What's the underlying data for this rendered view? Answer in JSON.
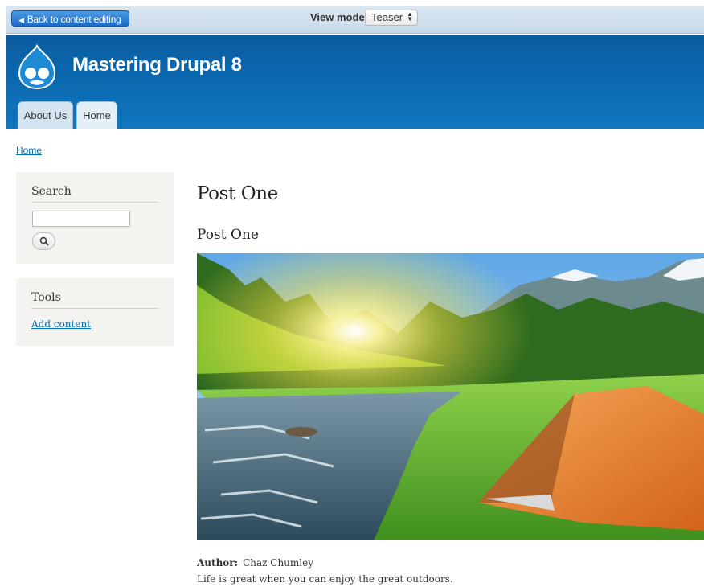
{
  "preview": {
    "back_label": "Back to content editing",
    "view_mode_label": "View mode:",
    "view_mode_value": "Teaser"
  },
  "site": {
    "name": "Mastering Drupal 8",
    "tabs": [
      {
        "label": "About Us"
      },
      {
        "label": "Home"
      }
    ]
  },
  "breadcrumb": "Home",
  "sidebar": {
    "search": {
      "title": "Search",
      "input_value": ""
    },
    "tools": {
      "title": "Tools",
      "link": "Add content"
    }
  },
  "main": {
    "page_title": "Post One",
    "node_title": "Post One",
    "author_label": "Author:",
    "author_name": "Chaz Chumley",
    "body": "Life is great when you can enjoy the great outdoors."
  },
  "colors": {
    "header": "#0a5c9f",
    "accent_button": "#1c6cc6",
    "link": "#0071b3"
  }
}
